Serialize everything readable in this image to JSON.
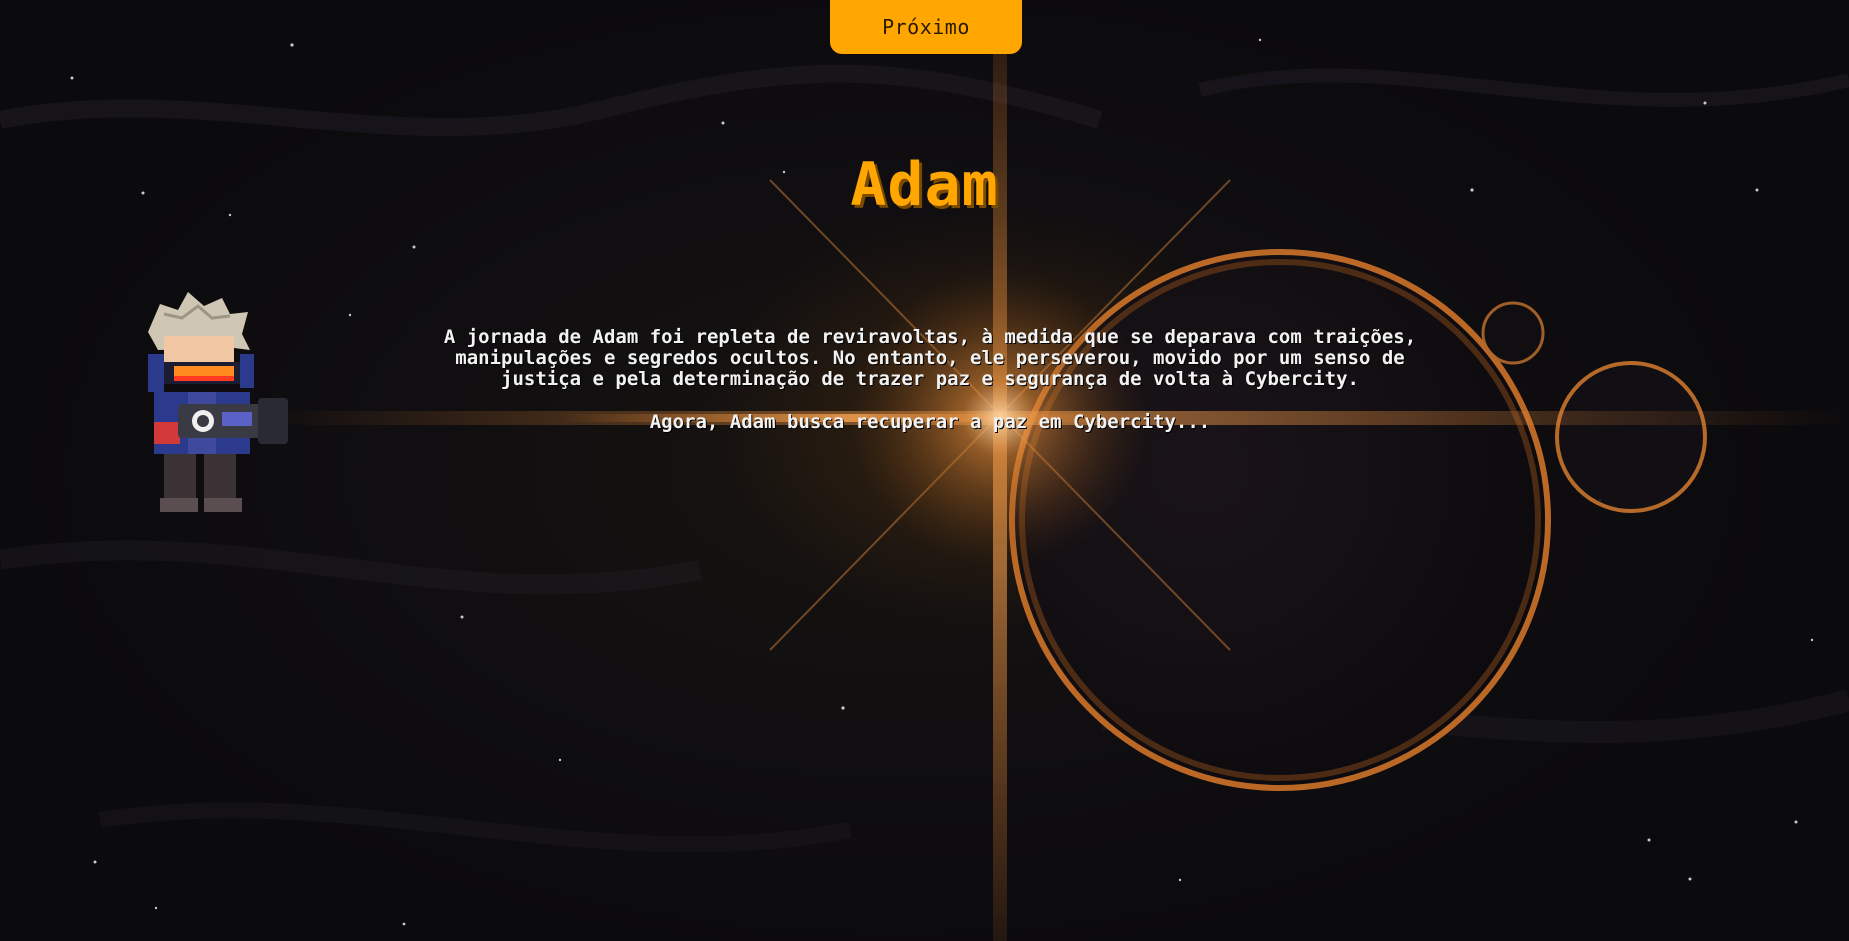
{
  "nav": {
    "next_label": "Próximo"
  },
  "character": {
    "name": "Adam",
    "sprite_icon": "armored-soldier-with-cannon"
  },
  "story": {
    "paragraph_1": "A jornada de Adam foi repleta de reviravoltas, à medida que se deparava com traições, manipulações e segredos ocultos. No entanto, ele perseverou, movido por um senso de justiça e pela determinação de trazer paz e segurança de volta à Cybercity.",
    "paragraph_2": "Agora, Adam busca recuperar a paz em Cybercity..."
  },
  "colors": {
    "accent": "#ffa600",
    "text": "#f2f2f2",
    "background": "#0d0c0f",
    "glow": "#d9792a"
  }
}
